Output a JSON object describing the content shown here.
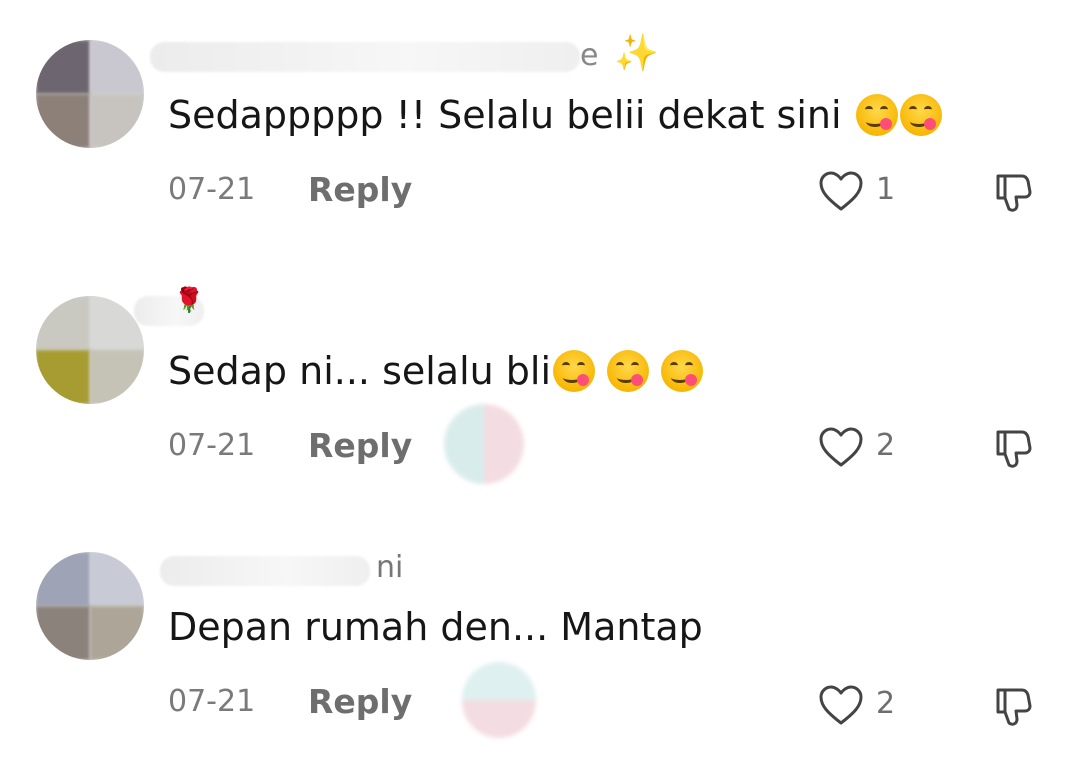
{
  "comments": [
    {
      "username_fragment": "e",
      "text": "Sedappppp !! Selalu belii dekat sini",
      "emoji_count": 2,
      "date": "07-21",
      "reply_label": "Reply",
      "likes": "1",
      "icons": [
        "heart-icon",
        "thumbs-down-icon",
        "face-savoring-food-emoji",
        "sparkles-emoji"
      ]
    },
    {
      "username_fragment": "",
      "text": "Sedap ni... selalu bli",
      "emoji_count": 3,
      "date": "07-21",
      "reply_label": "Reply",
      "likes": "2",
      "icons": [
        "heart-icon",
        "thumbs-down-icon",
        "face-savoring-food-emoji"
      ]
    },
    {
      "username_fragment": "ni",
      "text": "Depan rumah den... Mantap",
      "emoji_count": 0,
      "date": "07-21",
      "reply_label": "Reply",
      "likes": "2",
      "icons": [
        "heart-icon",
        "thumbs-down-icon"
      ]
    }
  ],
  "colors": {
    "text": "#161616",
    "meta": "#7a7a7a",
    "emoji": "#f7b500"
  }
}
